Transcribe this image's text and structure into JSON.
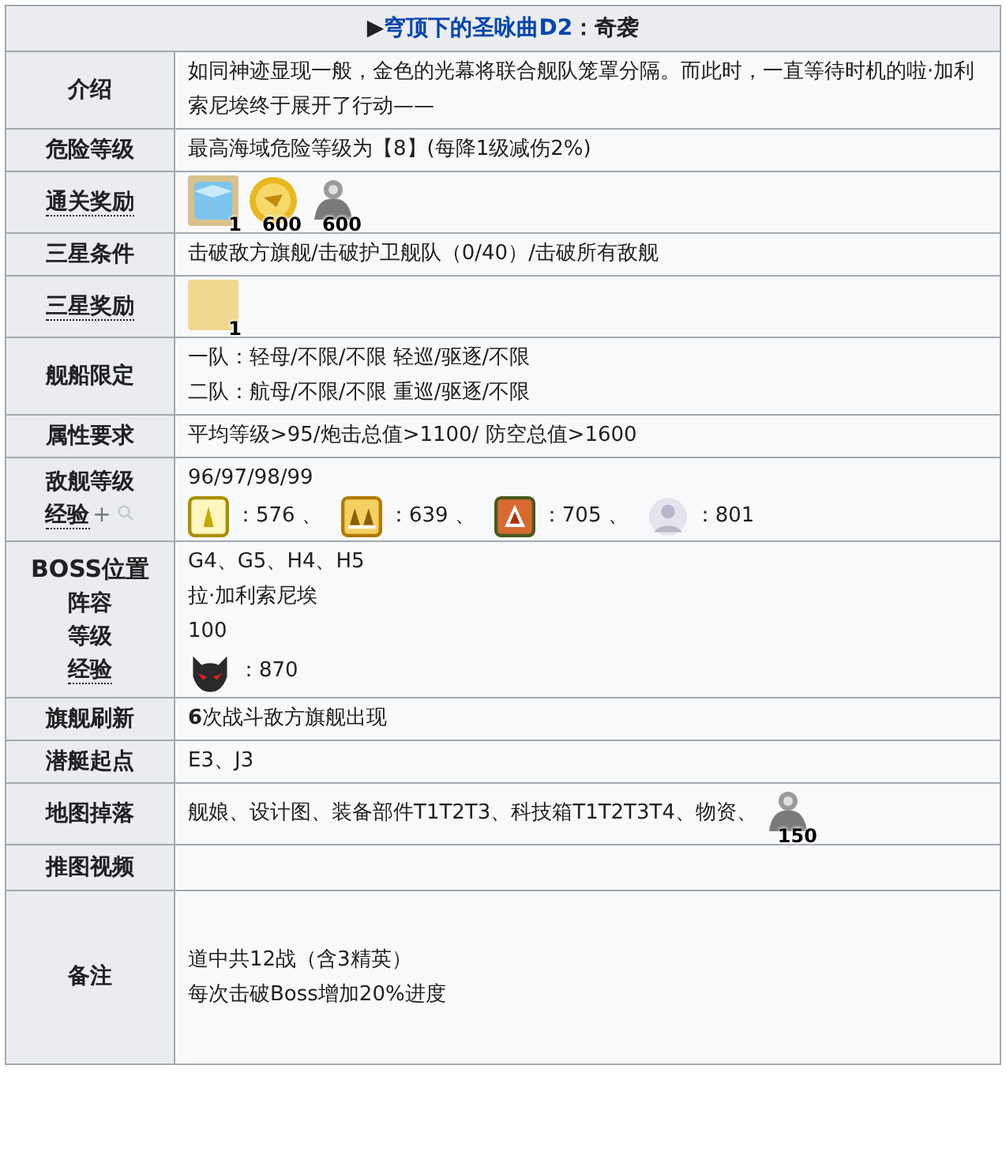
{
  "title": {
    "marker": "▶",
    "link": "穹顶下的圣咏曲D2",
    "rest": "：奇袭"
  },
  "rows": [
    {
      "kind": "text",
      "labels": [
        {
          "text": "介绍",
          "dotted": false
        }
      ],
      "lines": [
        "如同神迹显现一般，金色的光幕将联合舰队笼罩分隔。而此时，一直等待时机的啦·加利索尼埃终于展开了行动——"
      ]
    },
    {
      "kind": "text",
      "labels": [
        {
          "text": "危险等级",
          "dotted": false
        }
      ],
      "lines": [
        "最高海域危险等级为【8】(每降1级减伤2%)"
      ]
    },
    {
      "kind": "items",
      "labels": [
        {
          "text": "通关奖励",
          "dotted": true
        }
      ],
      "items": [
        {
          "count": "1"
        },
        {
          "count": "600"
        },
        {
          "count": "600"
        }
      ]
    },
    {
      "kind": "text",
      "labels": [
        {
          "text": "三星条件",
          "dotted": false
        }
      ],
      "lines": [
        "击破敌方旗舰/击破护卫舰队（0/40）/击破所有敌舰"
      ]
    },
    {
      "kind": "items",
      "labels": [
        {
          "text": "三星奖励",
          "dotted": true
        }
      ],
      "items": [
        {
          "count": "1"
        }
      ]
    },
    {
      "kind": "text",
      "labels": [
        {
          "text": "舰船限定",
          "dotted": false
        }
      ],
      "lines": [
        "一队：轻母/不限/不限 轻巡/驱逐/不限",
        "二队：航母/不限/不限 重巡/驱逐/不限"
      ]
    },
    {
      "kind": "text",
      "labels": [
        {
          "text": "属性要求",
          "dotted": false
        }
      ],
      "lines": [
        "平均等级>95/炮击总值>1100/ 防空总值>1600"
      ]
    },
    {
      "kind": "exp",
      "labels": [
        {
          "text": "敌舰等级",
          "dotted": false
        },
        {
          "text": "经验",
          "dotted": true,
          "plus": "+"
        }
      ],
      "lines": [
        "96/97/98/99"
      ],
      "exp": [
        {
          "text": "：576 、"
        },
        {
          "text": "：639 、"
        },
        {
          "text": "：705 、"
        },
        {
          "text": "：801"
        }
      ]
    },
    {
      "kind": "exp",
      "labels": [
        {
          "text": "BOSS位置",
          "dotted": false
        },
        {
          "text": "阵容",
          "dotted": false
        },
        {
          "text": "等级",
          "dotted": false
        },
        {
          "text": "经验",
          "dotted": true
        }
      ],
      "lines": [
        "G4、G5、H4、H5",
        "拉·加利索尼埃",
        "100"
      ],
      "exp": [
        {
          "text": "：870"
        }
      ]
    },
    {
      "kind": "text",
      "labels": [
        {
          "text": "旗舰刷新",
          "dotted": false
        }
      ],
      "lines": [
        "**6**次战斗敌方旗舰出现"
      ]
    },
    {
      "kind": "text",
      "labels": [
        {
          "text": "潜艇起点",
          "dotted": false
        }
      ],
      "lines": [
        "E3、J3"
      ]
    },
    {
      "kind": "drops",
      "labels": [
        {
          "text": "地图掉落",
          "dotted": false
        }
      ],
      "lines": [
        "舰娘、设计图、装备部件T1T2T3、科技箱T1T2T3T4、物资、"
      ],
      "items": [
        {
          "count": "150"
        }
      ]
    },
    {
      "kind": "empty",
      "labels": [
        {
          "text": "推图视频",
          "dotted": false
        }
      ]
    },
    {
      "kind": "tall",
      "labels": [
        {
          "text": "备注",
          "dotted": false
        }
      ],
      "lines": [
        "道中共12战（含3精英）",
        "每次击破Boss增加20%进度"
      ]
    }
  ]
}
